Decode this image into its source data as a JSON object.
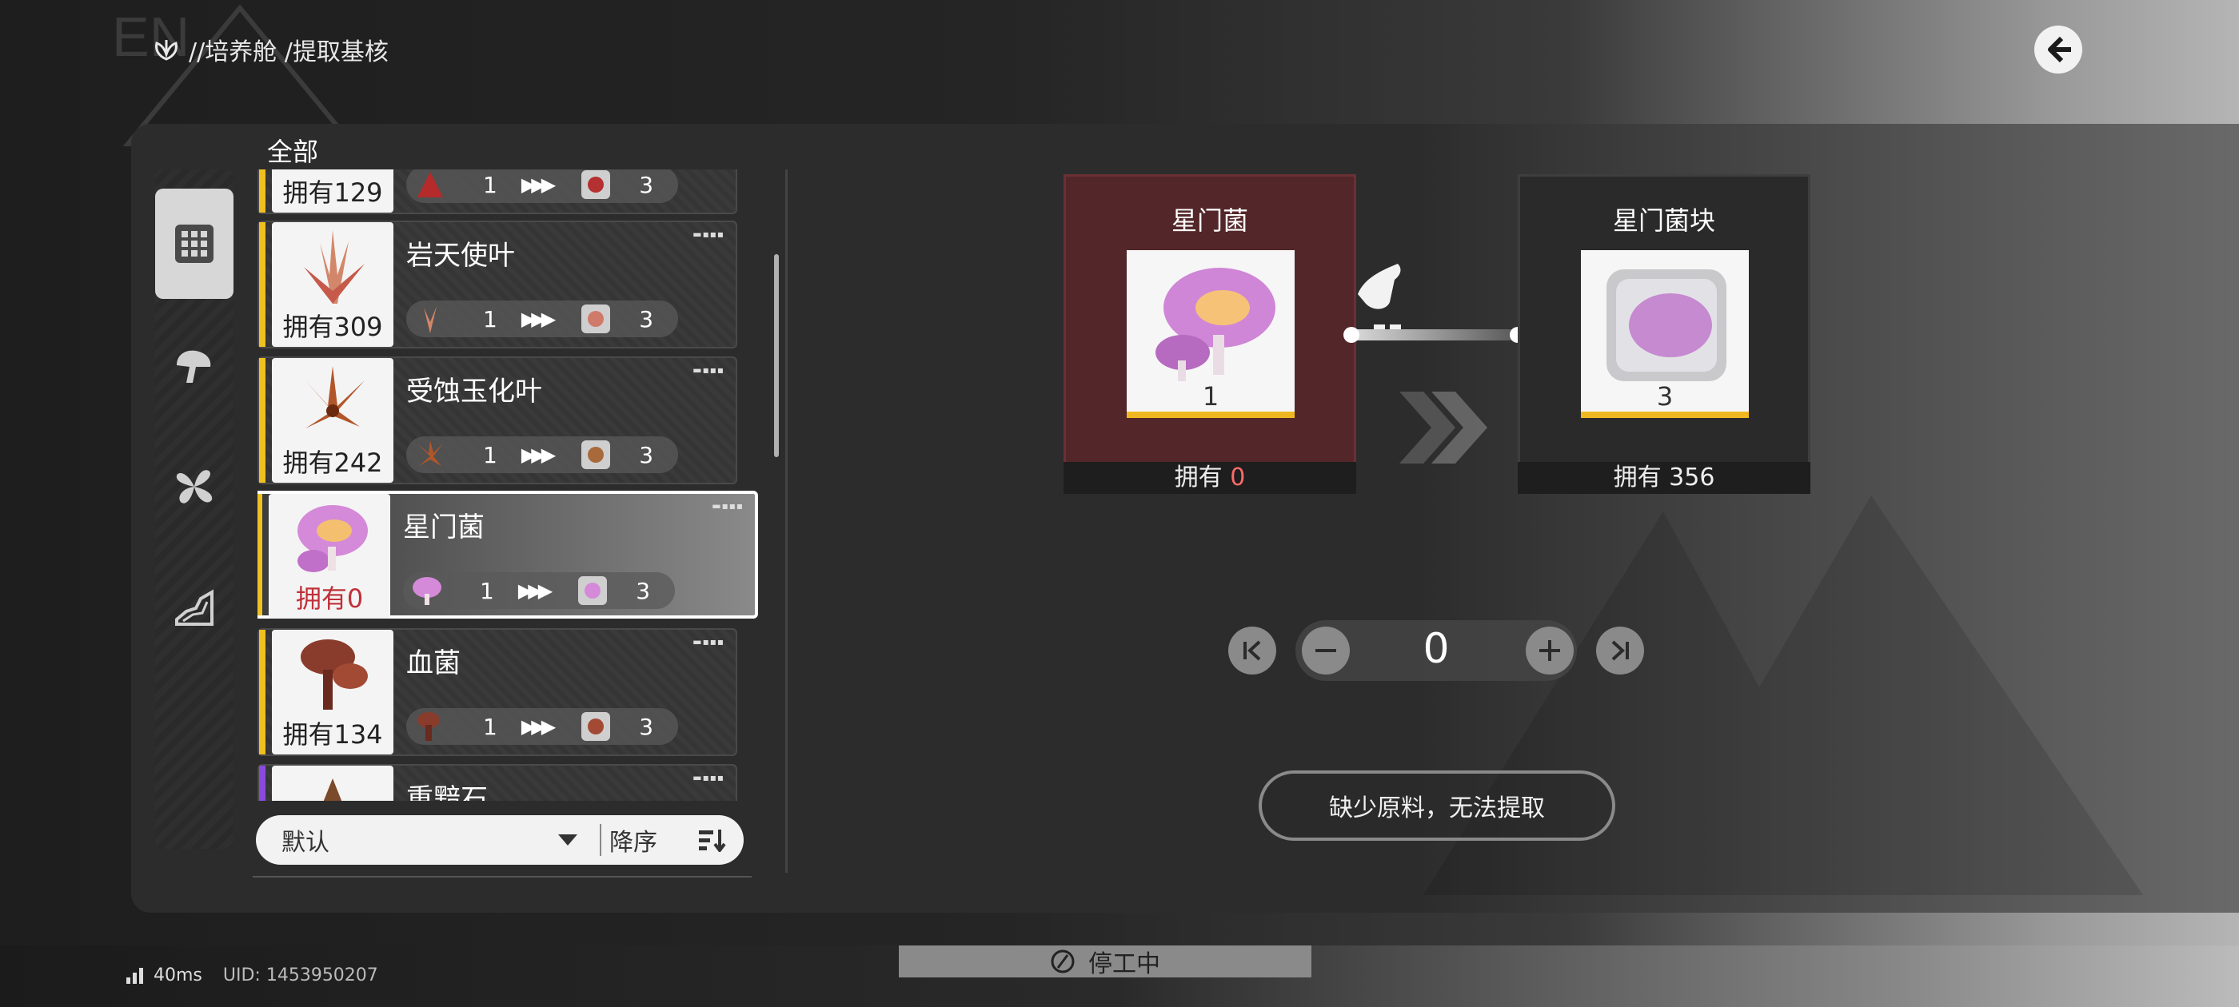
{
  "header": {
    "breadcrumb": "//培养舱 /提取基核",
    "icons": {
      "crumb": "plant-icon",
      "back": "back-arrow-icon"
    }
  },
  "sidebar": {
    "categories": [
      {
        "id": "all",
        "icon": "grid-icon",
        "active": true
      },
      {
        "id": "fungus",
        "icon": "mushroom-icon",
        "active": false
      },
      {
        "id": "plant",
        "icon": "flower-icon",
        "active": false
      },
      {
        "id": "mineral",
        "icon": "mineral-icon",
        "active": false
      }
    ]
  },
  "list": {
    "header_label": "全部",
    "items": [
      {
        "name": "",
        "owned": "拥有129",
        "qty_in": "1",
        "qty_out": "3",
        "icon": "red-leaf-icon"
      },
      {
        "name": "岩天使叶",
        "owned": "拥有309",
        "qty_in": "1",
        "qty_out": "3",
        "icon": "angel-leaf-icon"
      },
      {
        "name": "受蚀玉化叶",
        "owned": "拥有242",
        "qty_in": "1",
        "qty_out": "3",
        "icon": "jade-leaf-icon"
      },
      {
        "name": "星门菌",
        "owned": "拥有0",
        "qty_in": "1",
        "qty_out": "3",
        "icon": "stargate-fungus-icon",
        "selected": true
      },
      {
        "name": "血菌",
        "owned": "拥有134",
        "qty_in": "1",
        "qty_out": "3",
        "icon": "blood-fungus-icon"
      },
      {
        "name": "重黯石",
        "owned": "",
        "qty_in": "",
        "qty_out": "",
        "icon": "dark-stone-icon"
      }
    ],
    "sort": {
      "selected": "默认",
      "order": "降序"
    }
  },
  "recipe": {
    "source": {
      "title": "星门菌",
      "qty": "1",
      "owned_label": "拥有",
      "owned_value": "0"
    },
    "target": {
      "title": "星门菌块",
      "qty": "3",
      "owned_label": "拥有",
      "owned_value": "356"
    },
    "amount": "0",
    "extract_label": "缺少原料，无法提取"
  },
  "status": {
    "ping": "40ms",
    "uid": "UID: 1453950207",
    "state": "停工中"
  },
  "colors": {
    "rarity_gold": "#f0c020",
    "rarity_purple": "#8a4ae0",
    "missing_red": "#c0303a",
    "source_card": "#532729"
  }
}
